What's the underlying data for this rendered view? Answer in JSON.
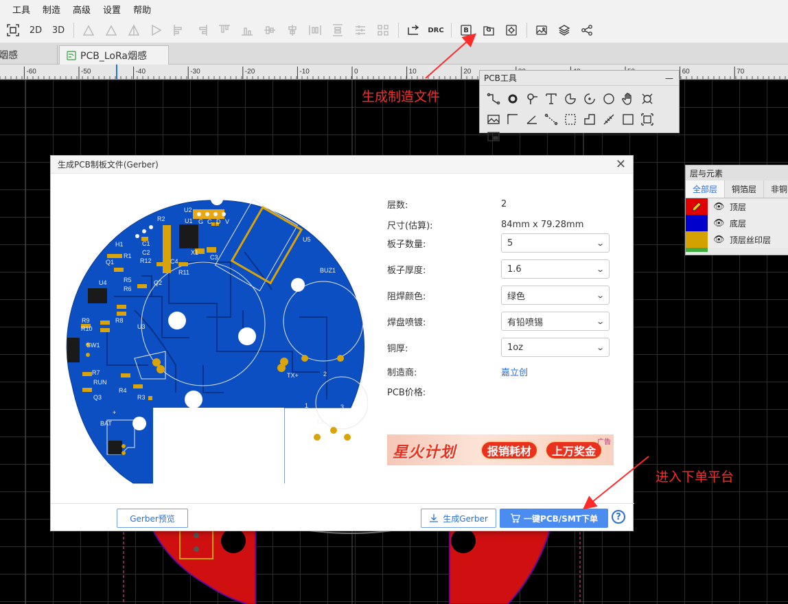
{
  "menu": {
    "items": [
      "工具",
      "制造",
      "高级",
      "设置",
      "帮助"
    ]
  },
  "toolbar": {
    "btn_2d": "2D",
    "btn_3d": "3D",
    "drc": "DRC",
    "gerber_btn": "G",
    "bom_btn": "B"
  },
  "tabs": {
    "left_partial": "烟感",
    "active": "PCB_LoRa烟感"
  },
  "ruler": {
    "labels": [
      "-60",
      "-50",
      "-40",
      "-30",
      "-20",
      "-10",
      "0",
      "10",
      "20",
      "30",
      "40",
      "50",
      "60",
      "70",
      "80"
    ]
  },
  "annotations": {
    "top": "生成制造文件",
    "bottom": "进入下单平台"
  },
  "pcb_tools": {
    "title": "PCB工具",
    "minimize": "—"
  },
  "layers": {
    "title": "层与元素",
    "tabs": [
      "全部层",
      "铜箔层",
      "非铜"
    ],
    "rows": [
      {
        "name": "顶层",
        "color": "#e00000"
      },
      {
        "name": "底层",
        "color": "#0000cc"
      },
      {
        "name": "顶层丝印层",
        "color": "#d4a200"
      }
    ]
  },
  "dialog": {
    "title": "生成PCB制板文件(Gerber)",
    "close": "✕",
    "props": {
      "layers_label": "层数:",
      "layers_value": "2",
      "size_label": "尺寸(估算):",
      "size_value": "84mm x 79.28mm",
      "qty_label": "板子数量:",
      "qty_value": "5",
      "thickness_label": "板子厚度:",
      "thickness_value": "1.6",
      "mask_label": "阻焊颜色:",
      "mask_value": "绿色",
      "finish_label": "焊盘喷镀:",
      "finish_value": "有铅喷锡",
      "copper_label": "铜厚:",
      "copper_value": "1oz",
      "mfr_label": "制造商:",
      "mfr_value": "嘉立创",
      "price_label": "PCB价格:"
    },
    "banner": {
      "title": "星火计划",
      "pill1": "报销耗材",
      "pill2": "上万奖金",
      "ad": "广告"
    },
    "footer": {
      "preview": "Gerber预览",
      "generate": "生成Gerber",
      "order": "一键PCB/SMT下单",
      "help": "?"
    }
  },
  "silkscreen": {
    "u2": "U2",
    "u1": "U1",
    "u3": "U3",
    "u4": "U4",
    "u5": "U5",
    "h1": "H1",
    "r2": "R2",
    "r1": "R1",
    "r5": "R5",
    "r6": "R6",
    "r7": "R7",
    "r8": "R8",
    "r9": "R9",
    "r10": "R10",
    "r11": "R11",
    "r12": "R12",
    "r3": "R3",
    "r4": "R4",
    "c1": "C1",
    "c2": "C2",
    "c3": "C3",
    "c4": "C4",
    "q1": "Q1",
    "q2": "Q2",
    "q3": "Q3",
    "x1": "X1",
    "buz1": "BUZ1",
    "l1": "L1",
    "sw": "SW1",
    "run": "RUN",
    "bat": "BAT",
    "txp": "TX+",
    "plus": "+",
    "pin_v": "V",
    "pin_d": "D",
    "pin_c": "C",
    "pin_g": "G",
    "n1": "1",
    "n2": "2",
    "n3": "3"
  }
}
